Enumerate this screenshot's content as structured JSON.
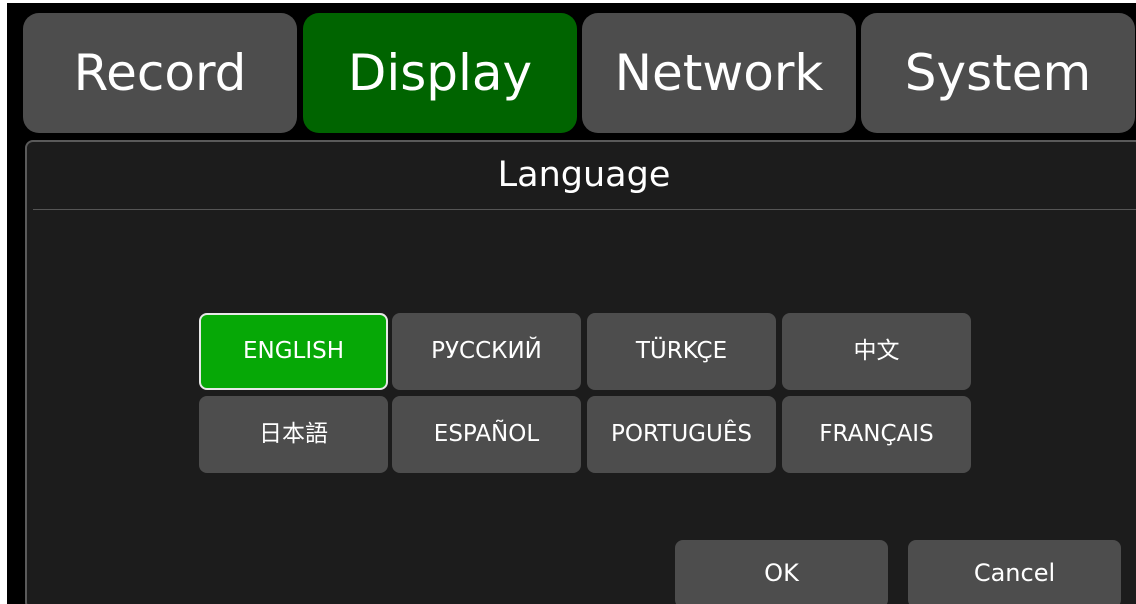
{
  "tabs": [
    {
      "label": "Record",
      "active": false
    },
    {
      "label": "Display",
      "active": true
    },
    {
      "label": "Network",
      "active": false
    },
    {
      "label": "System",
      "active": false
    }
  ],
  "panel": {
    "title": "Language"
  },
  "languages": [
    {
      "label": "ENGLISH",
      "selected": true
    },
    {
      "label": "РУССКИЙ",
      "selected": false
    },
    {
      "label": "TÜRKÇE",
      "selected": false
    },
    {
      "label": "中文",
      "selected": false
    },
    {
      "label": "日本語",
      "selected": false
    },
    {
      "label": "ESPAÑOL",
      "selected": false
    },
    {
      "label": "PORTUGUÊS",
      "selected": false
    },
    {
      "label": "FRANÇAIS",
      "selected": false
    }
  ],
  "actions": {
    "ok_label": "OK",
    "cancel_label": "Cancel"
  },
  "colors": {
    "active_tab": "#006400",
    "selected_language": "#06a806",
    "button": "#4d4d4d",
    "background": "#000000"
  }
}
